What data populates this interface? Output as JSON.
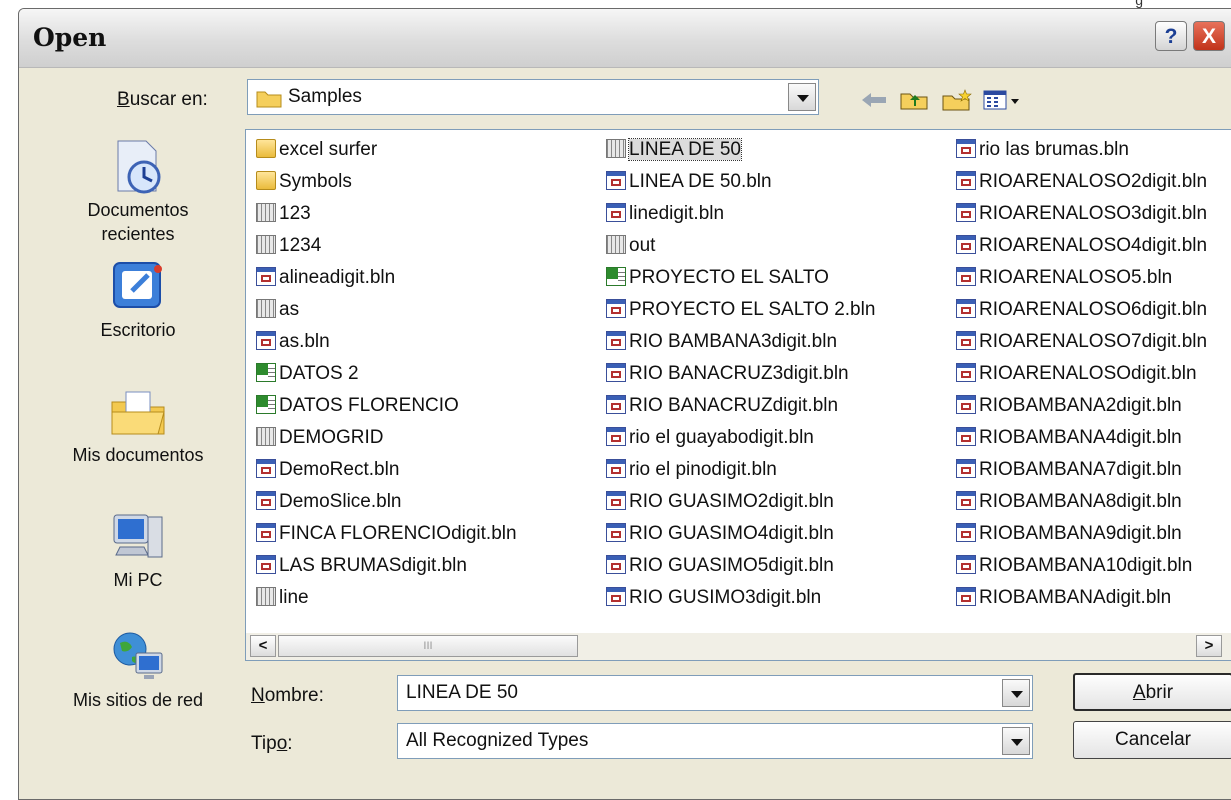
{
  "window": {
    "title": "Open",
    "help_label": "?",
    "close_label": "X"
  },
  "lookin": {
    "label": "Buscar en:",
    "value": "Samples"
  },
  "toolbar": {
    "icons": [
      "back-icon",
      "up-folder-icon",
      "new-folder-icon",
      "views-menu-icon"
    ]
  },
  "places": [
    {
      "label_line1": "Documentos",
      "label_line2": "recientes",
      "icon": "recent-documents-icon"
    },
    {
      "label_line1": "Escritorio",
      "label_line2": "",
      "icon": "desktop-icon"
    },
    {
      "label_line1": "Mis documentos",
      "label_line2": "",
      "icon": "my-documents-icon"
    },
    {
      "label_line1": "Mi PC",
      "label_line2": "",
      "icon": "my-computer-icon"
    },
    {
      "label_line1": "Mis sitios de red",
      "label_line2": "",
      "icon": "network-places-icon"
    }
  ],
  "files": {
    "col1": [
      {
        "name": "excel surfer",
        "type": "folder"
      },
      {
        "name": "Symbols",
        "type": "folder"
      },
      {
        "name": "123",
        "type": "grid"
      },
      {
        "name": "1234",
        "type": "grid"
      },
      {
        "name": "alineadigit.bln",
        "type": "bln"
      },
      {
        "name": "as",
        "type": "grid"
      },
      {
        "name": "as.bln",
        "type": "bln"
      },
      {
        "name": "DATOS 2",
        "type": "xls"
      },
      {
        "name": "DATOS FLORENCIO",
        "type": "xls"
      },
      {
        "name": "DEMOGRID",
        "type": "grid"
      },
      {
        "name": "DemoRect.bln",
        "type": "bln"
      },
      {
        "name": "DemoSlice.bln",
        "type": "bln"
      },
      {
        "name": "FINCA FLORENCIOdigit.bln",
        "type": "bln"
      },
      {
        "name": "LAS BRUMASdigit.bln",
        "type": "bln"
      },
      {
        "name": "line",
        "type": "grid"
      }
    ],
    "col2": [
      {
        "name": "LINEA DE 50",
        "type": "grid",
        "selected": true
      },
      {
        "name": "LINEA DE 50.bln",
        "type": "bln"
      },
      {
        "name": "linedigit.bln",
        "type": "bln"
      },
      {
        "name": "out",
        "type": "grid"
      },
      {
        "name": "PROYECTO EL SALTO",
        "type": "xls"
      },
      {
        "name": "PROYECTO EL SALTO 2.bln",
        "type": "bln"
      },
      {
        "name": "RIO BAMBANA3digit.bln",
        "type": "bln"
      },
      {
        "name": "RIO BANACRUZ3digit.bln",
        "type": "bln"
      },
      {
        "name": "RIO BANACRUZdigit.bln",
        "type": "bln"
      },
      {
        "name": "rio el guayabodigit.bln",
        "type": "bln"
      },
      {
        "name": "rio el pinodigit.bln",
        "type": "bln"
      },
      {
        "name": "RIO GUASIMO2digit.bln",
        "type": "bln"
      },
      {
        "name": "RIO GUASIMO4digit.bln",
        "type": "bln"
      },
      {
        "name": "RIO GUASIMO5digit.bln",
        "type": "bln"
      },
      {
        "name": "RIO GUSIMO3digit.bln",
        "type": "bln"
      }
    ],
    "col3": [
      {
        "name": "rio las brumas.bln",
        "type": "bln"
      },
      {
        "name": "RIOARENALOSO2digit.bln",
        "type": "bln"
      },
      {
        "name": "RIOARENALOSO3digit.bln",
        "type": "bln"
      },
      {
        "name": "RIOARENALOSO4digit.bln",
        "type": "bln"
      },
      {
        "name": "RIOARENALOSO5.bln",
        "type": "bln"
      },
      {
        "name": "RIOARENALOSO6digit.bln",
        "type": "bln"
      },
      {
        "name": "RIOARENALOSO7digit.bln",
        "type": "bln"
      },
      {
        "name": "RIOARENALOSOdigit.bln",
        "type": "bln"
      },
      {
        "name": "RIOBAMBANA2digit.bln",
        "type": "bln"
      },
      {
        "name": "RIOBAMBANA4digit.bln",
        "type": "bln"
      },
      {
        "name": "RIOBAMBANA7digit.bln",
        "type": "bln"
      },
      {
        "name": "RIOBAMBANA8digit.bln",
        "type": "bln"
      },
      {
        "name": "RIOBAMBANA9digit.bln",
        "type": "bln"
      },
      {
        "name": "RIOBAMBANA10digit.bln",
        "type": "bln"
      },
      {
        "name": "RIOBAMBANAdigit.bln",
        "type": "bln"
      }
    ]
  },
  "scrollbar": {
    "left_arrow": "<",
    "right_arrow": ">",
    "thumb_grip": "III"
  },
  "filename": {
    "label": "Nombre:",
    "value": "LINEA DE 50"
  },
  "filetype": {
    "label": "Tipo:",
    "value": "All Recognized Types"
  },
  "buttons": {
    "open_pre": "",
    "open_u": "A",
    "open_post": "brir",
    "cancel": "Cancelar"
  },
  "colors": {
    "dialog_bg": "#ece9d8",
    "list_bg": "#ffffff",
    "border": "#7f9db9",
    "close_red": "#c1331a"
  }
}
